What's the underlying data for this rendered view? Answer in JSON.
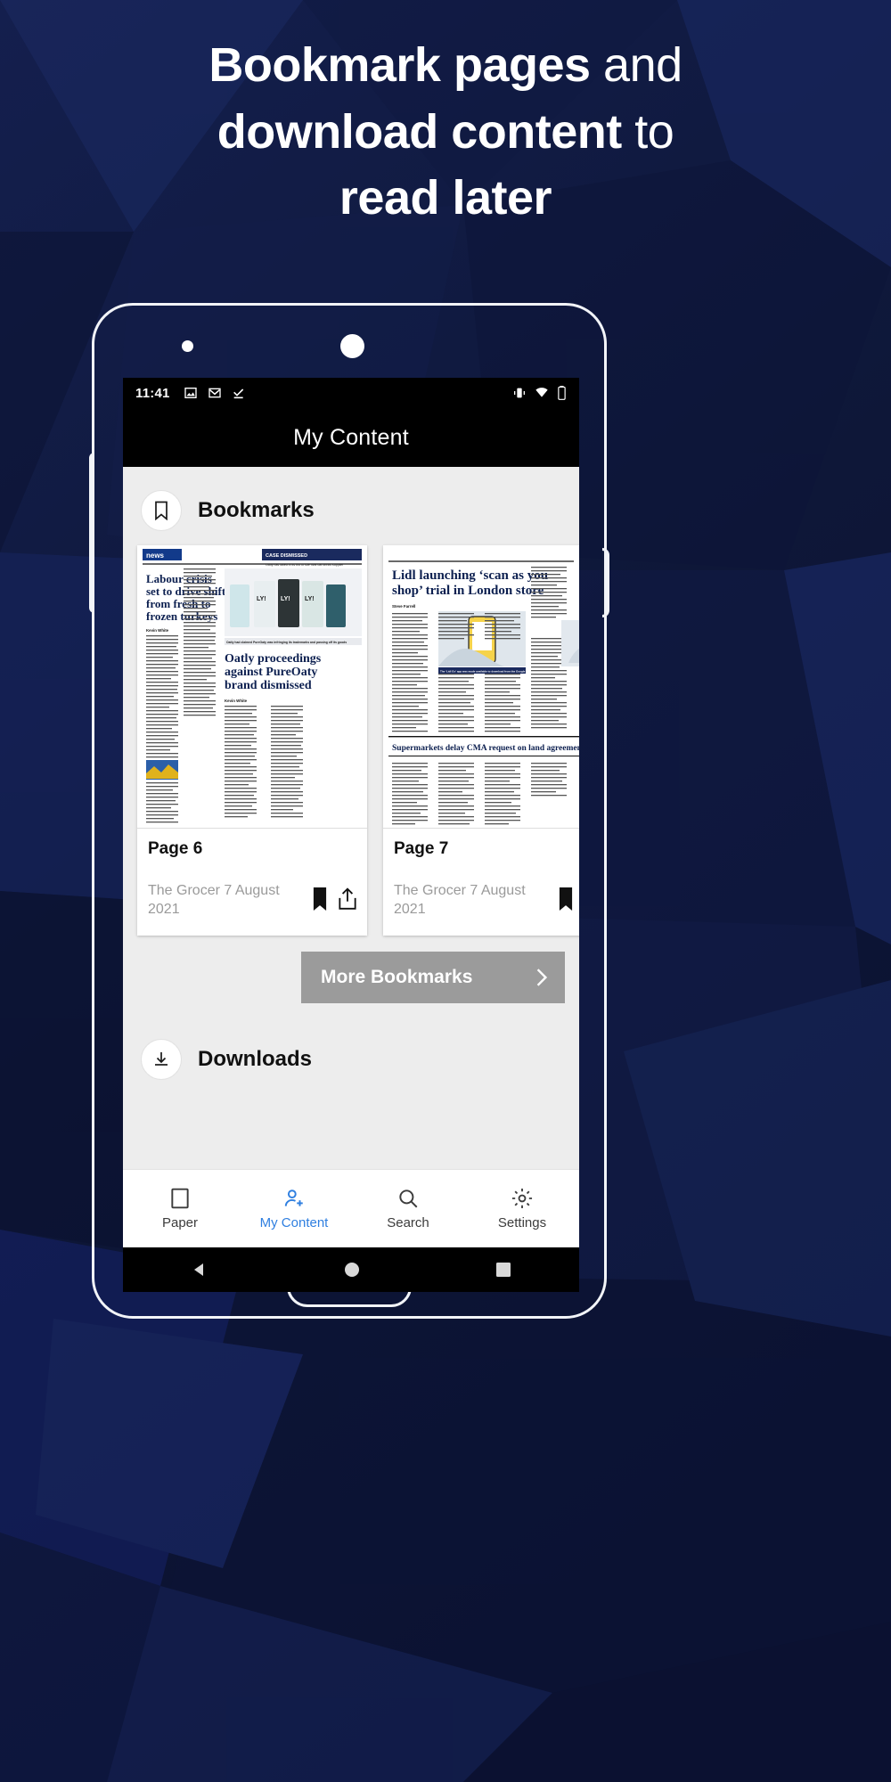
{
  "headline": {
    "line1_bold": "Bookmark pages",
    "line1_light": " and",
    "line2_bold": "download content",
    "line2_light": " to",
    "line3": "read later"
  },
  "colors": {
    "background_dark": "#0d1430",
    "background_mid": "#152052",
    "accent_blue": "#2f7fe0",
    "button_grey": "#9b9b9b",
    "screen_bg": "#ededed"
  },
  "phone": {
    "status_bar": {
      "time": "11:41",
      "left_icons": [
        "image-icon",
        "gmail-icon",
        "task-check-icon"
      ],
      "right_icons": [
        "vibrate-icon",
        "wifi-icon",
        "battery-icon"
      ]
    },
    "title_bar": {
      "title": "My Content"
    },
    "sections": [
      {
        "id": "bookmarks",
        "icon": "bookmark-outline-icon",
        "title": "Bookmarks"
      },
      {
        "id": "downloads",
        "icon": "download-icon",
        "title": "Downloads"
      }
    ],
    "bookmark_cards": [
      {
        "page_label": "Page 6",
        "date": "The Grocer 7 August 2021",
        "actions": [
          "bookmark-filled-icon",
          "share-icon"
        ],
        "thumbnail": {
          "masthead": "news",
          "kicker": "CASE DISMISSED",
          "kicker_sub": "Oatly has failed in its bid to sue rival oat drinks supplier Globe Farm",
          "headline_left": "Labour crisis set to drive shift from fresh to frozen turkeys",
          "byline_left": "Kevin White",
          "photo_caption": "Oatly had claimed PureOaty was infringing its trademarks and passing off its goods",
          "headline_right": "Oatly proceedings against PureOaty brand dismissed",
          "byline_right": "Kevin White",
          "product_labels": [
            "LY!",
            "LY!",
            "LY!"
          ]
        }
      },
      {
        "page_label": "Page 7",
        "date": "The Grocer 7 August 2021",
        "actions": [
          "bookmark-filled-icon",
          "share-icon"
        ],
        "thumbnail": {
          "headline_main": "Lidl launching ‘scan as you shop’ trial in London store",
          "byline": "Steve Farrell",
          "photo_caption": "The ‘Lidl Go’ app was made available to download from the Google Play store on 2 August",
          "headline_sub": "Supermarkets delay CMA request on land agreements"
        }
      }
    ],
    "more_button": {
      "label": "More Bookmarks",
      "icon": "chevron-right-icon"
    },
    "bottom_nav": [
      {
        "label": "Paper",
        "icon": "paper-icon",
        "active": false
      },
      {
        "label": "My Content",
        "icon": "my-content-icon",
        "active": true
      },
      {
        "label": "Search",
        "icon": "search-icon",
        "active": false
      },
      {
        "label": "Settings",
        "icon": "gear-icon",
        "active": false
      }
    ],
    "android_nav": [
      "back-triangle-icon",
      "home-circle-icon",
      "recents-square-icon"
    ]
  }
}
